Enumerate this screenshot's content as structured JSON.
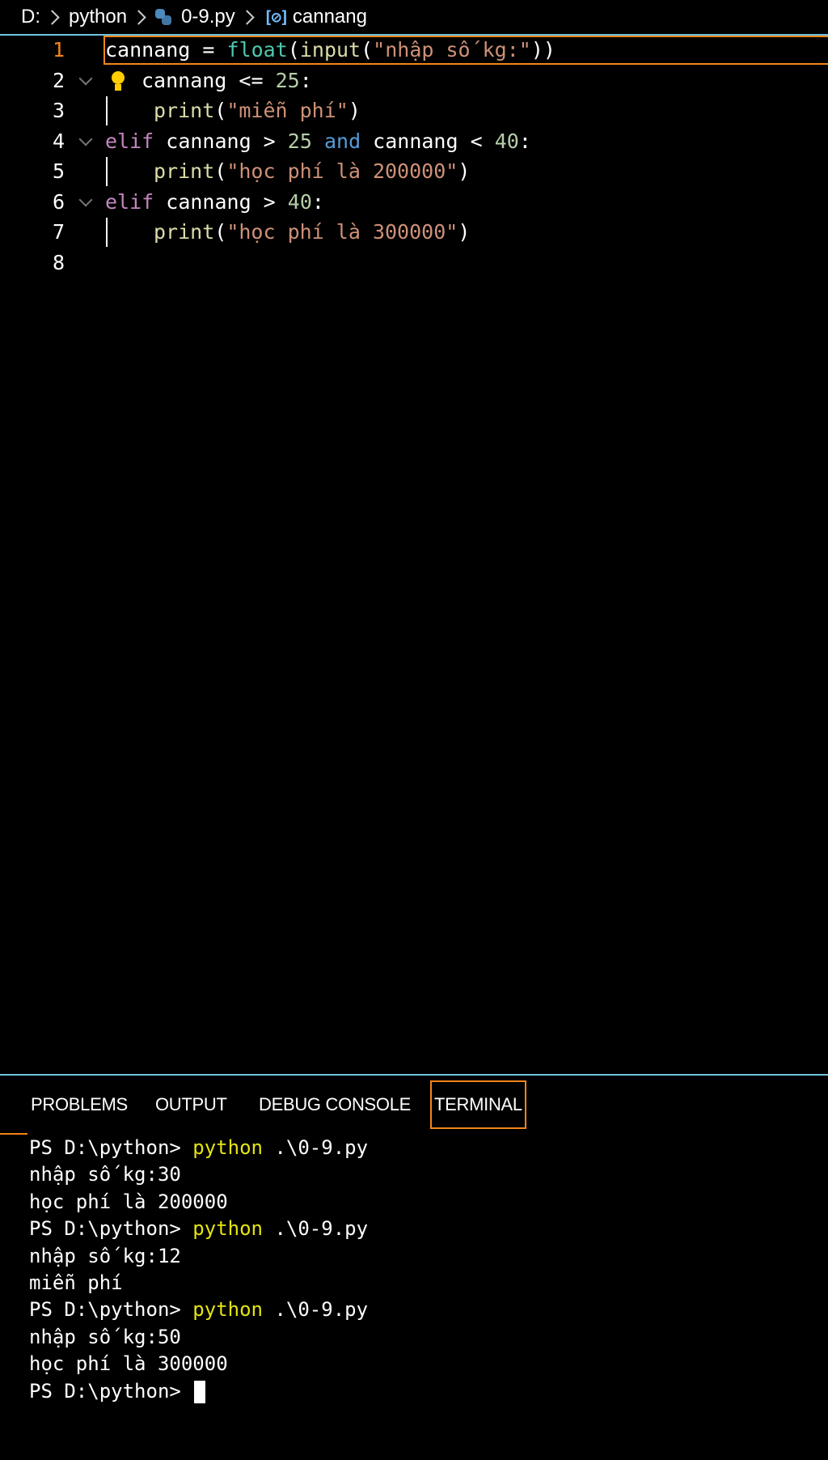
{
  "breadcrumb": {
    "drive": "D:",
    "folder": "python",
    "file": "0-9.py",
    "symbol_icon_text": "[⊘]",
    "symbol": "cannang"
  },
  "editor": {
    "lines": [
      {
        "number": "1",
        "tokens": [
          {
            "t": "cannang = ",
            "c": "plain"
          },
          {
            "t": "float",
            "c": "fn-cls"
          },
          {
            "t": "(",
            "c": "plain"
          },
          {
            "t": "input",
            "c": "fn"
          },
          {
            "t": "(",
            "c": "plain"
          },
          {
            "t": "\"nhập số kg:\"",
            "c": "str"
          },
          {
            "t": "))",
            "c": "plain"
          }
        ]
      },
      {
        "number": "2",
        "tokens": [
          {
            "t": "cannang <= ",
            "c": "plain"
          },
          {
            "t": "25",
            "c": "num"
          },
          {
            "t": ":",
            "c": "plain"
          }
        ]
      },
      {
        "number": "3",
        "tokens": [
          {
            "t": "print",
            "c": "fn"
          },
          {
            "t": "(",
            "c": "plain"
          },
          {
            "t": "\"miễn phí\"",
            "c": "str"
          },
          {
            "t": ")",
            "c": "plain"
          }
        ]
      },
      {
        "number": "4",
        "tokens": [
          {
            "t": "elif",
            "c": "k-ctrl"
          },
          {
            "t": " cannang > ",
            "c": "plain"
          },
          {
            "t": "25",
            "c": "num"
          },
          {
            "t": " ",
            "c": "plain"
          },
          {
            "t": "and",
            "c": "k-and"
          },
          {
            "t": " cannang < ",
            "c": "plain"
          },
          {
            "t": "40",
            "c": "num"
          },
          {
            "t": ":",
            "c": "plain"
          }
        ]
      },
      {
        "number": "5",
        "tokens": [
          {
            "t": "print",
            "c": "fn"
          },
          {
            "t": "(",
            "c": "plain"
          },
          {
            "t": "\"học phí là 200000\"",
            "c": "str"
          },
          {
            "t": ")",
            "c": "plain"
          }
        ]
      },
      {
        "number": "6",
        "tokens": [
          {
            "t": "elif",
            "c": "k-ctrl"
          },
          {
            "t": " cannang > ",
            "c": "plain"
          },
          {
            "t": "40",
            "c": "num"
          },
          {
            "t": ":",
            "c": "plain"
          }
        ]
      },
      {
        "number": "7",
        "tokens": [
          {
            "t": "print",
            "c": "fn"
          },
          {
            "t": "(",
            "c": "plain"
          },
          {
            "t": "\"học phí là 300000\"",
            "c": "str"
          },
          {
            "t": ")",
            "c": "plain"
          }
        ]
      },
      {
        "number": "8",
        "tokens": []
      }
    ]
  },
  "panel": {
    "tabs": [
      "PROBLEMS",
      "OUTPUT",
      "DEBUG CONSOLE",
      "TERMINAL"
    ],
    "active_tab": "TERMINAL"
  },
  "terminal": {
    "lines": [
      {
        "prompt": "PS D:\\python> ",
        "cmd": "python",
        "args": " .\\0-9.py"
      },
      {
        "text": "nhập số kg:30"
      },
      {
        "text": "học phí là 200000"
      },
      {
        "prompt": "PS D:\\python> ",
        "cmd": "python",
        "args": " .\\0-9.py"
      },
      {
        "text": "nhập số kg:12"
      },
      {
        "text": "miễn phí"
      },
      {
        "prompt": "PS D:\\python> ",
        "cmd": "python",
        "args": " .\\0-9.py"
      },
      {
        "text": "nhập số kg:50"
      },
      {
        "text": "học phí là 300000"
      },
      {
        "prompt": "PS D:\\python> ",
        "cursor": true
      }
    ]
  },
  "colors": {
    "accent_focus": "#f38518",
    "border_line": "#6fc3df",
    "terminal_cmd": "#e5e510"
  }
}
